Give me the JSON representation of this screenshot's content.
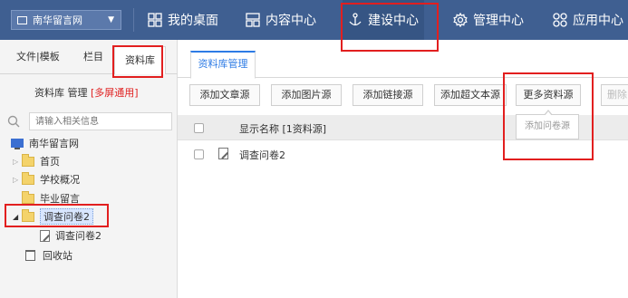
{
  "topbar": {
    "site_select": "南华留言网",
    "nav": [
      {
        "label": "我的桌面",
        "icon": "grid-icon"
      },
      {
        "label": "内容中心",
        "icon": "layout-icon"
      },
      {
        "label": "建设中心",
        "icon": "anchor-icon"
      },
      {
        "label": "管理中心",
        "icon": "gear-icon"
      },
      {
        "label": "应用中心",
        "icon": "apps-icon"
      }
    ]
  },
  "leftpanel": {
    "tabs": [
      "文件|模板",
      "栏目",
      "资料库"
    ],
    "active_tab": "资料库",
    "subtitle": "资料库 管理",
    "subtitle_tag": "[多屏通用]",
    "search_placeholder": "请输入相关信息",
    "tree": {
      "root": "南华留言网",
      "items": [
        "首页",
        "学校概况",
        "毕业留言",
        "调查问卷2"
      ],
      "child": "调查问卷2",
      "recycle": "回收站"
    }
  },
  "main": {
    "tab": "资料库管理",
    "buttons": [
      "添加文章源",
      "添加图片源",
      "添加链接源",
      "添加超文本源",
      "更多资料源",
      "删除"
    ],
    "tooltip": "添加问卷源",
    "header": "显示名称 [1资料源]",
    "rows": [
      {
        "name": "调查问卷2"
      }
    ]
  },
  "colors": {
    "topbar": "#3f5f91",
    "accent": "#2d7be5",
    "highlight": "#e21f1f"
  }
}
